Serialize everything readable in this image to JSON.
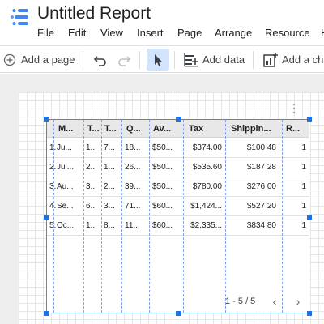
{
  "app": {
    "title": "Untitled Report",
    "menu": [
      "File",
      "Edit",
      "View",
      "Insert",
      "Page",
      "Arrange",
      "Resource",
      "He"
    ]
  },
  "toolbar": {
    "add_page_label": "Add a page",
    "add_data_label": "Add data",
    "add_chart_label": "Add a cha",
    "icons": [
      "add-circle-icon",
      "undo-icon",
      "redo-icon",
      "select-pointer-icon",
      "add-data-icon",
      "add-chart-icon"
    ]
  },
  "table": {
    "columns": [
      "M...",
      "T...",
      "T...",
      "Q...",
      "Av...",
      "Tax",
      "Shippin...",
      "R..."
    ],
    "rows": [
      {
        "index": "1.",
        "cells": [
          "Ju...",
          "1...",
          "7...",
          "18...",
          "$50...",
          "$374.00",
          "$100.48",
          "1"
        ]
      },
      {
        "index": "2.",
        "cells": [
          "Jul...",
          "2...",
          "1...",
          "26...",
          "$50...",
          "$535.60",
          "$187.28",
          "1"
        ]
      },
      {
        "index": "3.",
        "cells": [
          "Au...",
          "3...",
          "2...",
          "39...",
          "$50...",
          "$780.00",
          "$276.00",
          "1"
        ]
      },
      {
        "index": "4.",
        "cells": [
          "Se...",
          "6...",
          "3...",
          "71...",
          "$60...",
          "$1,424...",
          "$527.20",
          "1"
        ]
      },
      {
        "index": "5.",
        "cells": [
          "Oc...",
          "1...",
          "8...",
          "11...",
          "$60...",
          "$2,335...",
          "$834.80",
          "1"
        ]
      }
    ],
    "pagination": "1 - 5 / 5"
  },
  "colors": {
    "selection": "#4a86e8",
    "handle": "#1a73e8",
    "select_tool_bg": "#d2e3fc"
  }
}
